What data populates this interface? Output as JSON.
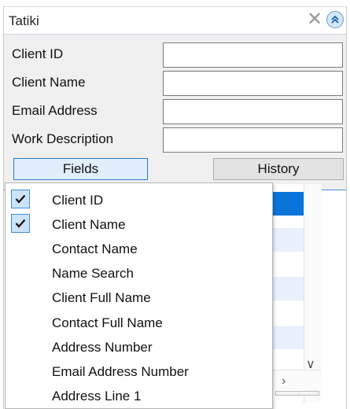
{
  "window": {
    "title": "Tatiki"
  },
  "icons": {
    "close": "close-icon",
    "collapse": "chevron-double-up-icon",
    "check": "checkmark-icon"
  },
  "form": {
    "client_id_label": "Client ID",
    "client_name_label": "Client Name",
    "email_label": "Email Address",
    "work_description_label": "Work Description",
    "client_id_value": "",
    "client_name_value": "",
    "email_value": "",
    "work_description_value": ""
  },
  "tabs": {
    "fields": "Fields",
    "history": "History"
  },
  "menu": {
    "items": [
      {
        "label": "Client ID",
        "checked": true
      },
      {
        "label": "Client Name",
        "checked": true
      },
      {
        "label": "Contact Name",
        "checked": false
      },
      {
        "label": "Name Search",
        "checked": false
      },
      {
        "label": "Client Full Name",
        "checked": false
      },
      {
        "label": "Contact Full Name",
        "checked": false
      },
      {
        "label": "Address Number",
        "checked": false
      },
      {
        "label": "Email Address Number",
        "checked": false
      },
      {
        "label": "Address Line 1",
        "checked": false
      }
    ]
  },
  "colors": {
    "accent": "#2f78c4",
    "selection": "#0a74da",
    "panel": "#f0f0f0"
  }
}
